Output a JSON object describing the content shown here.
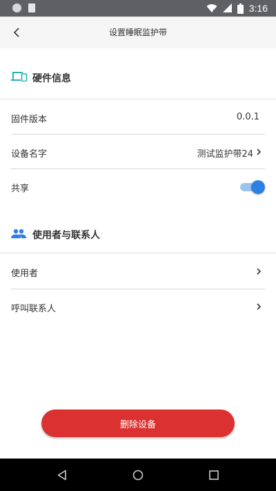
{
  "status_bar": {
    "time": "3:16",
    "icons": [
      "notification-dot-icon",
      "sd-card-icon",
      "wifi-icon",
      "signal-icon",
      "battery-icon"
    ]
  },
  "header": {
    "title": "设置睡眠监护带"
  },
  "hardware_section": {
    "title": "硬件信息",
    "icon": "devices-icon",
    "icon_color": "#1fb5ad",
    "firmware": {
      "label": "固件版本",
      "value": "0.0.1"
    },
    "device_name": {
      "label": "设备名字",
      "value": "测试监护带24"
    },
    "share": {
      "label": "共享",
      "enabled": true
    }
  },
  "users_section": {
    "title": "使用者与联系人",
    "icon": "people-icon",
    "icon_color": "#2f80e5",
    "user": {
      "label": "使用者"
    },
    "call_contact": {
      "label": "呼叫联系人"
    }
  },
  "actions": {
    "delete_label": "删除设备",
    "delete_color": "#db3131"
  },
  "accent_color": "#2f80e5"
}
